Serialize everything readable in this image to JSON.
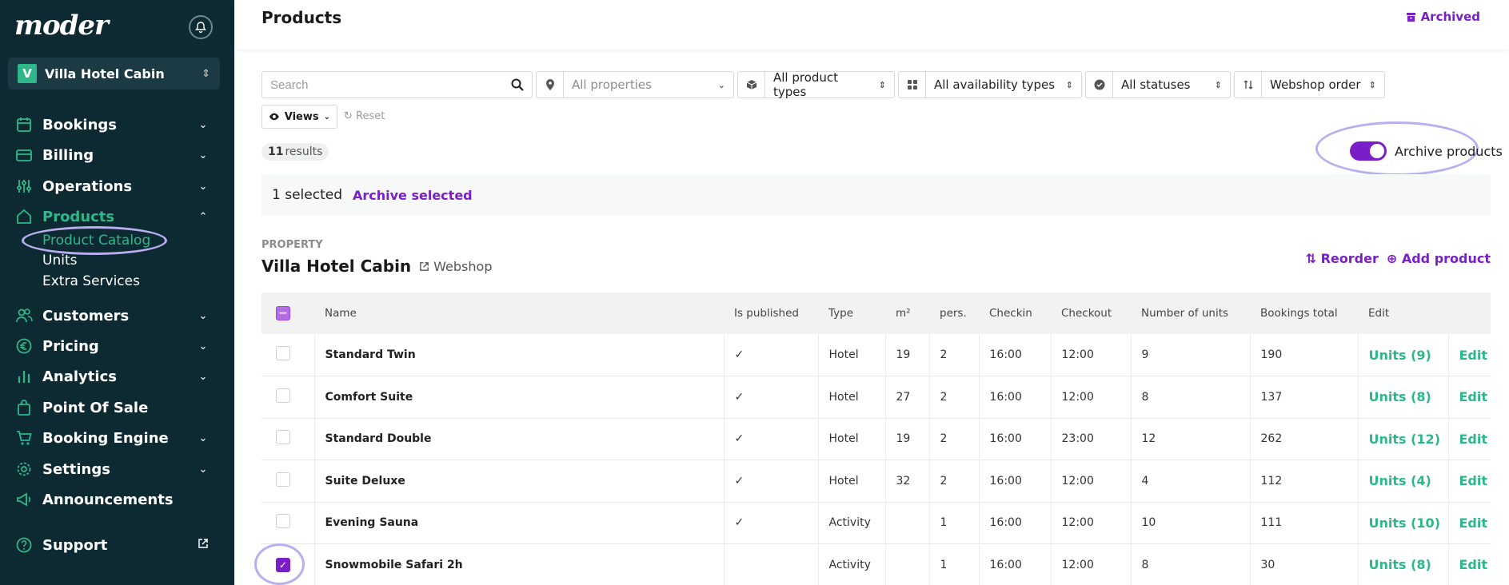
{
  "sidebar": {
    "logo": "moder",
    "property": {
      "badge": "V",
      "name": "Villa Hotel Cabin"
    },
    "items": [
      {
        "label": "Bookings",
        "icon": "calendar-icon",
        "chevron": "down"
      },
      {
        "label": "Billing",
        "icon": "credit-card-icon",
        "chevron": "down"
      },
      {
        "label": "Operations",
        "icon": "sliders-icon",
        "chevron": "down"
      },
      {
        "label": "Products",
        "icon": "home-icon",
        "chevron": "up",
        "active": true
      },
      {
        "label": "Customers",
        "icon": "users-icon",
        "chevron": "down"
      },
      {
        "label": "Pricing",
        "icon": "euro-icon",
        "chevron": "down"
      },
      {
        "label": "Analytics",
        "icon": "chart-icon",
        "chevron": "down"
      },
      {
        "label": "Point Of Sale",
        "icon": "bag-icon",
        "chevron": ""
      },
      {
        "label": "Booking Engine",
        "icon": "cart-icon",
        "chevron": "down"
      },
      {
        "label": "Settings",
        "icon": "gear-icon",
        "chevron": "down"
      },
      {
        "label": "Announcements",
        "icon": "megaphone-icon",
        "chevron": ""
      }
    ],
    "subitems": [
      {
        "label": "Product Catalog",
        "active": true
      },
      {
        "label": "Units"
      },
      {
        "label": "Extra Services"
      }
    ],
    "support": "Support"
  },
  "header": {
    "title": "Products",
    "archived": "Archived"
  },
  "filters": {
    "search_placeholder": "Search",
    "properties": "All properties",
    "product_types": "All product types",
    "availability_types": "All availability types",
    "statuses": "All statuses",
    "order": "Webshop order"
  },
  "toolbar": {
    "views": "Views",
    "reset": "Reset",
    "results_count": "11",
    "results_label": "results",
    "archive_toggle_label": "Archive products"
  },
  "selection": {
    "count_text": "1 selected",
    "action": "Archive selected"
  },
  "property_section": {
    "label": "PROPERTY",
    "name": "Villa Hotel Cabin",
    "webshop": "Webshop",
    "reorder": "Reorder",
    "add_product": "Add product"
  },
  "table": {
    "columns": [
      "Name",
      "Is published",
      "Type",
      "m²",
      "pers.",
      "Checkin",
      "Checkout",
      "Number of units",
      "Bookings total",
      "Edit"
    ],
    "rows": [
      {
        "name": "Standard Twin",
        "published": "✓",
        "type": "Hotel",
        "m2": "19",
        "pers": "2",
        "checkin": "16:00",
        "checkout": "12:00",
        "units": "9",
        "bookings": "190",
        "units_link": "Units (9)",
        "edit": "Edit",
        "checked": false
      },
      {
        "name": "Comfort Suite",
        "published": "✓",
        "type": "Hotel",
        "m2": "27",
        "pers": "2",
        "checkin": "16:00",
        "checkout": "12:00",
        "units": "8",
        "bookings": "137",
        "units_link": "Units (8)",
        "edit": "Edit",
        "checked": false
      },
      {
        "name": "Standard Double",
        "published": "✓",
        "type": "Hotel",
        "m2": "19",
        "pers": "2",
        "checkin": "16:00",
        "checkout": "23:00",
        "units": "12",
        "bookings": "262",
        "units_link": "Units (12)",
        "edit": "Edit",
        "checked": false
      },
      {
        "name": "Suite Deluxe",
        "published": "✓",
        "type": "Hotel",
        "m2": "32",
        "pers": "2",
        "checkin": "16:00",
        "checkout": "12:00",
        "units": "4",
        "bookings": "112",
        "units_link": "Units (4)",
        "edit": "Edit",
        "checked": false
      },
      {
        "name": "Evening Sauna",
        "published": "✓",
        "type": "Activity",
        "m2": "",
        "pers": "1",
        "checkin": "16:00",
        "checkout": "12:00",
        "units": "10",
        "bookings": "111",
        "units_link": "Units (10)",
        "edit": "Edit",
        "checked": false
      },
      {
        "name": "Snowmobile Safari 2h",
        "published": "",
        "type": "Activity",
        "m2": "",
        "pers": "1",
        "checkin": "16:00",
        "checkout": "12:00",
        "units": "8",
        "bookings": "30",
        "units_link": "Units (8)",
        "edit": "Edit",
        "checked": true
      }
    ]
  },
  "colors": {
    "sidebar_bg": "#0d2a33",
    "accent_green": "#2eb88a",
    "accent_purple": "#7a1fc8",
    "highlight_circle": "#b8aef0"
  }
}
